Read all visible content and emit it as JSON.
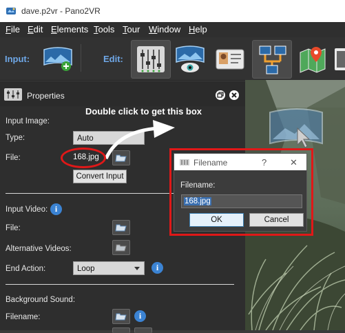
{
  "window": {
    "title": "dave.p2vr - Pano2VR"
  },
  "menu": [
    {
      "label": "File",
      "key": "F",
      "rest": "ile"
    },
    {
      "label": "Edit",
      "key": "E",
      "rest": "dit"
    },
    {
      "label": "Elements",
      "key": "E",
      "rest": "lements"
    },
    {
      "label": "Tools",
      "key": "T",
      "rest": "ools"
    },
    {
      "label": "Tour",
      "key": "T",
      "rest": "our"
    },
    {
      "label": "Window",
      "key": "W",
      "rest": "indow"
    },
    {
      "label": "Help",
      "key": "H",
      "rest": "elp"
    }
  ],
  "toolbar": {
    "input_label": "Input:",
    "edit_label": "Edit:"
  },
  "properties": {
    "title": "Properties",
    "input_image_heading": "Input Image:",
    "type_label": "Type:",
    "type_value": "Auto",
    "file_label": "File:",
    "file_value": "168.jpg",
    "convert_button": "Convert Input",
    "input_video_heading": "Input Video:",
    "video_file_label": "File:",
    "alt_videos_label": "Alternative Videos:",
    "end_action_label": "End Action:",
    "end_action_value": "Loop",
    "background_sound_heading": "Background Sound:",
    "filename_label": "Filename:"
  },
  "annotation": {
    "caption": "Double click to get this box"
  },
  "dialog": {
    "title": "Filename",
    "help": "?",
    "close": "✕",
    "field_label": "Filename:",
    "field_value": "168.jpg",
    "ok": "OK",
    "cancel": "Cancel"
  },
  "colors": {
    "accent": "#3b83d3",
    "highlight": "#e01818",
    "toolbar_label": "#6fa8e8"
  }
}
